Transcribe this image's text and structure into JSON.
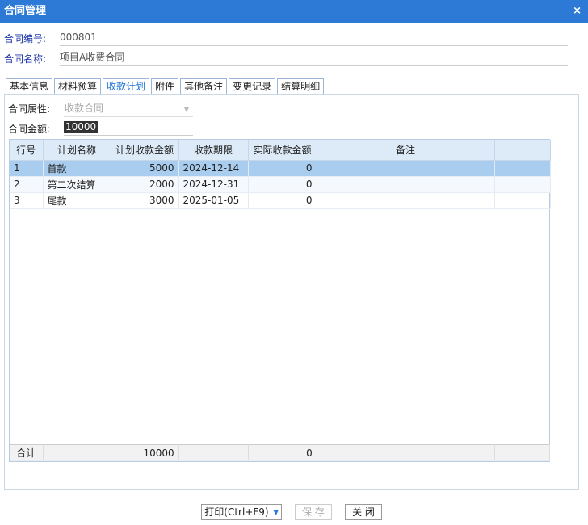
{
  "window": {
    "title": "合同管理",
    "close_glyph": "×"
  },
  "contract": {
    "code_label": "合同编号:",
    "code_value": "000801",
    "name_label": "合同名称:",
    "name_value": "项目A收费合同"
  },
  "tabs": [
    {
      "label": "基本信息",
      "active": false
    },
    {
      "label": "材料预算",
      "active": false
    },
    {
      "label": "收款计划",
      "active": true
    },
    {
      "label": "附件",
      "active": false
    },
    {
      "label": "其他备注",
      "active": false
    },
    {
      "label": "变更记录",
      "active": false
    },
    {
      "label": "结算明细",
      "active": false
    }
  ],
  "props": {
    "attr_label": "合同属性:",
    "attr_value": "收款合同",
    "amount_label": "合同金额:",
    "amount_value": "10000"
  },
  "grid": {
    "headers": [
      "行号",
      "计划名称",
      "计划收款金额",
      "收款期限",
      "实际收款金额",
      "备注"
    ],
    "rows": [
      {
        "no": "1",
        "name": "首款",
        "plan": "5000",
        "due": "2024-12-14",
        "actual": "0",
        "note": ""
      },
      {
        "no": "2",
        "name": "第二次结算",
        "plan": "2000",
        "due": "2024-12-31",
        "actual": "0",
        "note": ""
      },
      {
        "no": "3",
        "name": "尾款",
        "plan": "3000",
        "due": "2025-01-05",
        "actual": "0",
        "note": ""
      }
    ],
    "footer": {
      "label": "合计",
      "plan_total": "10000",
      "actual_total": "0"
    }
  },
  "buttons": {
    "print": "打印(Ctrl+F9)",
    "save": "保 存",
    "close": "关 闭"
  }
}
